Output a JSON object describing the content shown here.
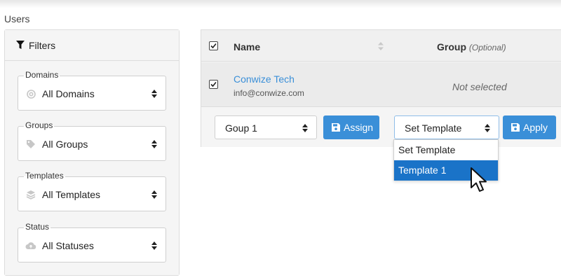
{
  "page": {
    "title": "Users"
  },
  "filters": {
    "header": "Filters",
    "groups": [
      {
        "legend": "Domains",
        "value": "All Domains",
        "icon": "at-icon"
      },
      {
        "legend": "Groups",
        "value": "All Groups",
        "icon": "tag-icon"
      },
      {
        "legend": "Templates",
        "value": "All Templates",
        "icon": "layers-icon"
      },
      {
        "legend": "Status",
        "value": "All Statuses",
        "icon": "cloud-icon"
      }
    ]
  },
  "table": {
    "columns": {
      "name": "Name",
      "group": "Group",
      "group_hint": "(Optional)"
    },
    "rows": [
      {
        "name": "Conwize Tech",
        "email": "info@conwize.com",
        "group": "Not selected",
        "checked": true
      }
    ]
  },
  "actions": {
    "group_select": "Goup 1",
    "assign_label": "Assign",
    "template_select": "Set Template",
    "apply_label": "Apply"
  },
  "template_dropdown": {
    "options": [
      "Set Template",
      "Template 1"
    ],
    "highlighted": "Template 1"
  },
  "colors": {
    "accent": "#3a8fd8",
    "highlight": "#1a73c8"
  }
}
